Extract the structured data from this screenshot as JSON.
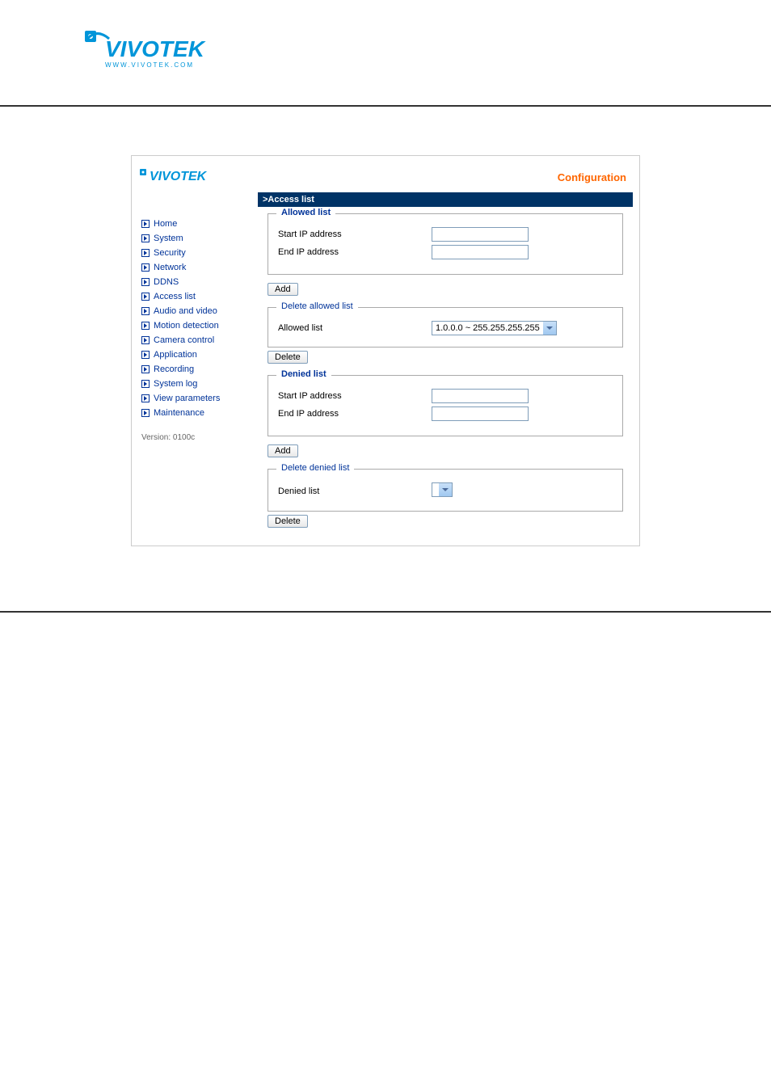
{
  "brand": "VIVOTEK",
  "brand_url": "WWW.VIVOTEK.COM",
  "header": {
    "config_label": "Configuration"
  },
  "title_bar": ">Access list",
  "sidebar": {
    "items": [
      {
        "label": "Home"
      },
      {
        "label": "System"
      },
      {
        "label": "Security"
      },
      {
        "label": "Network"
      },
      {
        "label": "DDNS"
      },
      {
        "label": "Access list"
      },
      {
        "label": "Audio and video"
      },
      {
        "label": "Motion detection"
      },
      {
        "label": "Camera control"
      },
      {
        "label": "Application"
      },
      {
        "label": "Recording"
      },
      {
        "label": "System log"
      },
      {
        "label": "View parameters"
      },
      {
        "label": "Maintenance"
      }
    ],
    "version": "Version: 0100c"
  },
  "allowed": {
    "legend": "Allowed list",
    "start_ip_label": "Start IP address",
    "end_ip_label": "End IP address",
    "add_btn": "Add",
    "delete_legend": "Delete allowed list",
    "list_label": "Allowed list",
    "list_selected": "1.0.0.0 ~ 255.255.255.255",
    "delete_btn": "Delete"
  },
  "denied": {
    "legend": "Denied list",
    "start_ip_label": "Start IP address",
    "end_ip_label": "End IP address",
    "add_btn": "Add",
    "delete_legend": "Delete denied list",
    "list_label": "Denied list",
    "list_selected": "",
    "delete_btn": "Delete"
  }
}
